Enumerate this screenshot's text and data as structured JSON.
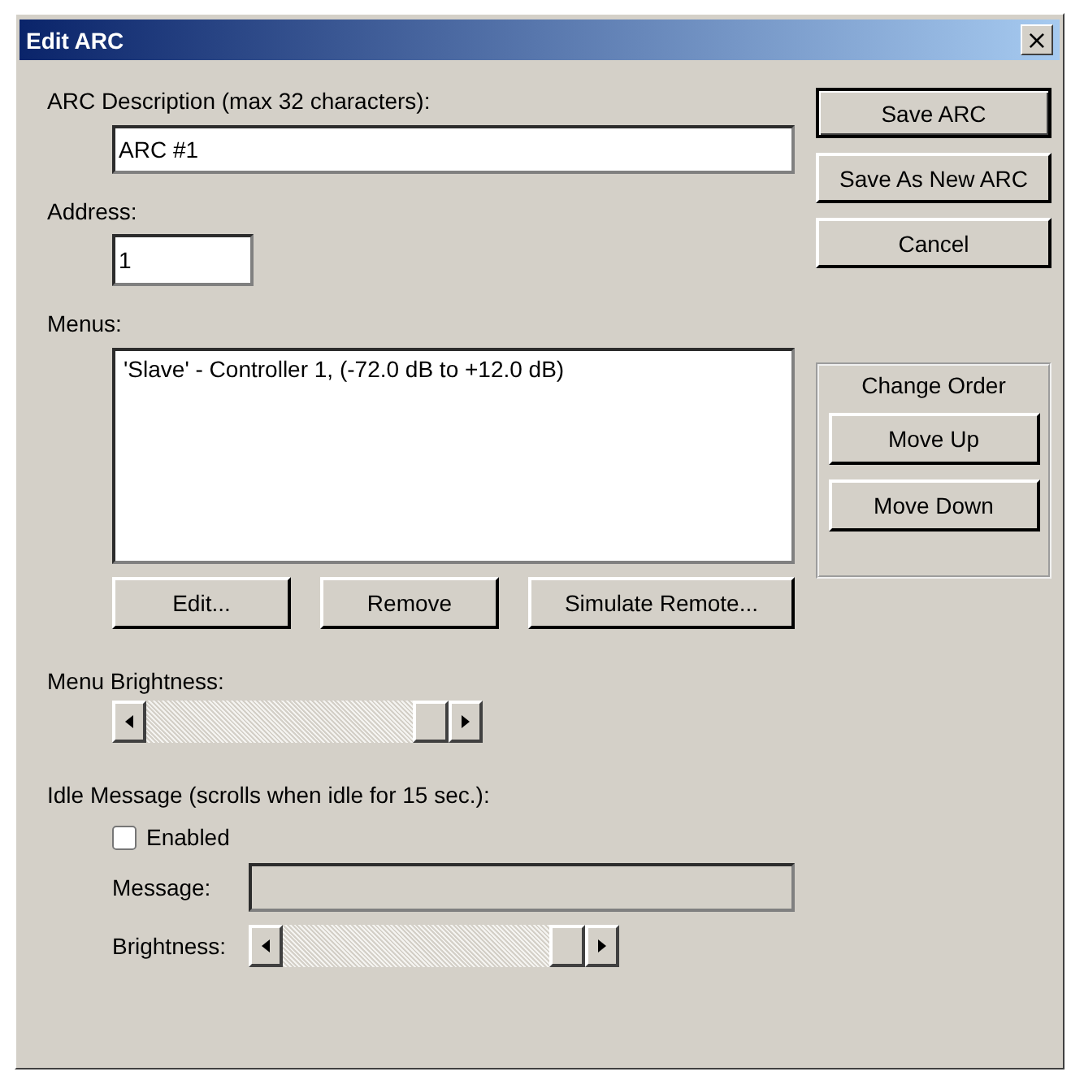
{
  "window": {
    "title": "Edit ARC",
    "close": "×"
  },
  "description": {
    "label": "ARC Description (max 32 characters):",
    "value": "ARC #1"
  },
  "address": {
    "label": "Address:",
    "value": "1"
  },
  "actions": [
    {
      "label": "Save ARC",
      "default": true
    },
    {
      "label": "Save As New ARC",
      "default": false
    },
    {
      "label": "Cancel",
      "default": false
    }
  ],
  "menus": {
    "label": "Menus:",
    "items": [
      {
        "text": "'Slave' - Controller 1, (-72.0 dB to +12.0 dB)",
        "selected": false
      }
    ],
    "buttons": [
      "Edit...",
      "Remove",
      "Simulate Remote..."
    ]
  },
  "change_order": {
    "title": "Change Order",
    "buttons": [
      "Move Up",
      "Move Down"
    ]
  },
  "menu_brightness": {
    "label": "Menu Brightness:",
    "level": 1
  },
  "idle_message": {
    "label": "Idle Message (scrolls when idle for 15 sec.):",
    "enabled": {
      "label": "Enabled",
      "checked": false
    },
    "message": {
      "label": "Message:",
      "disabled": true
    },
    "brightness": {
      "label": "Brightness:",
      "level": 1
    }
  }
}
